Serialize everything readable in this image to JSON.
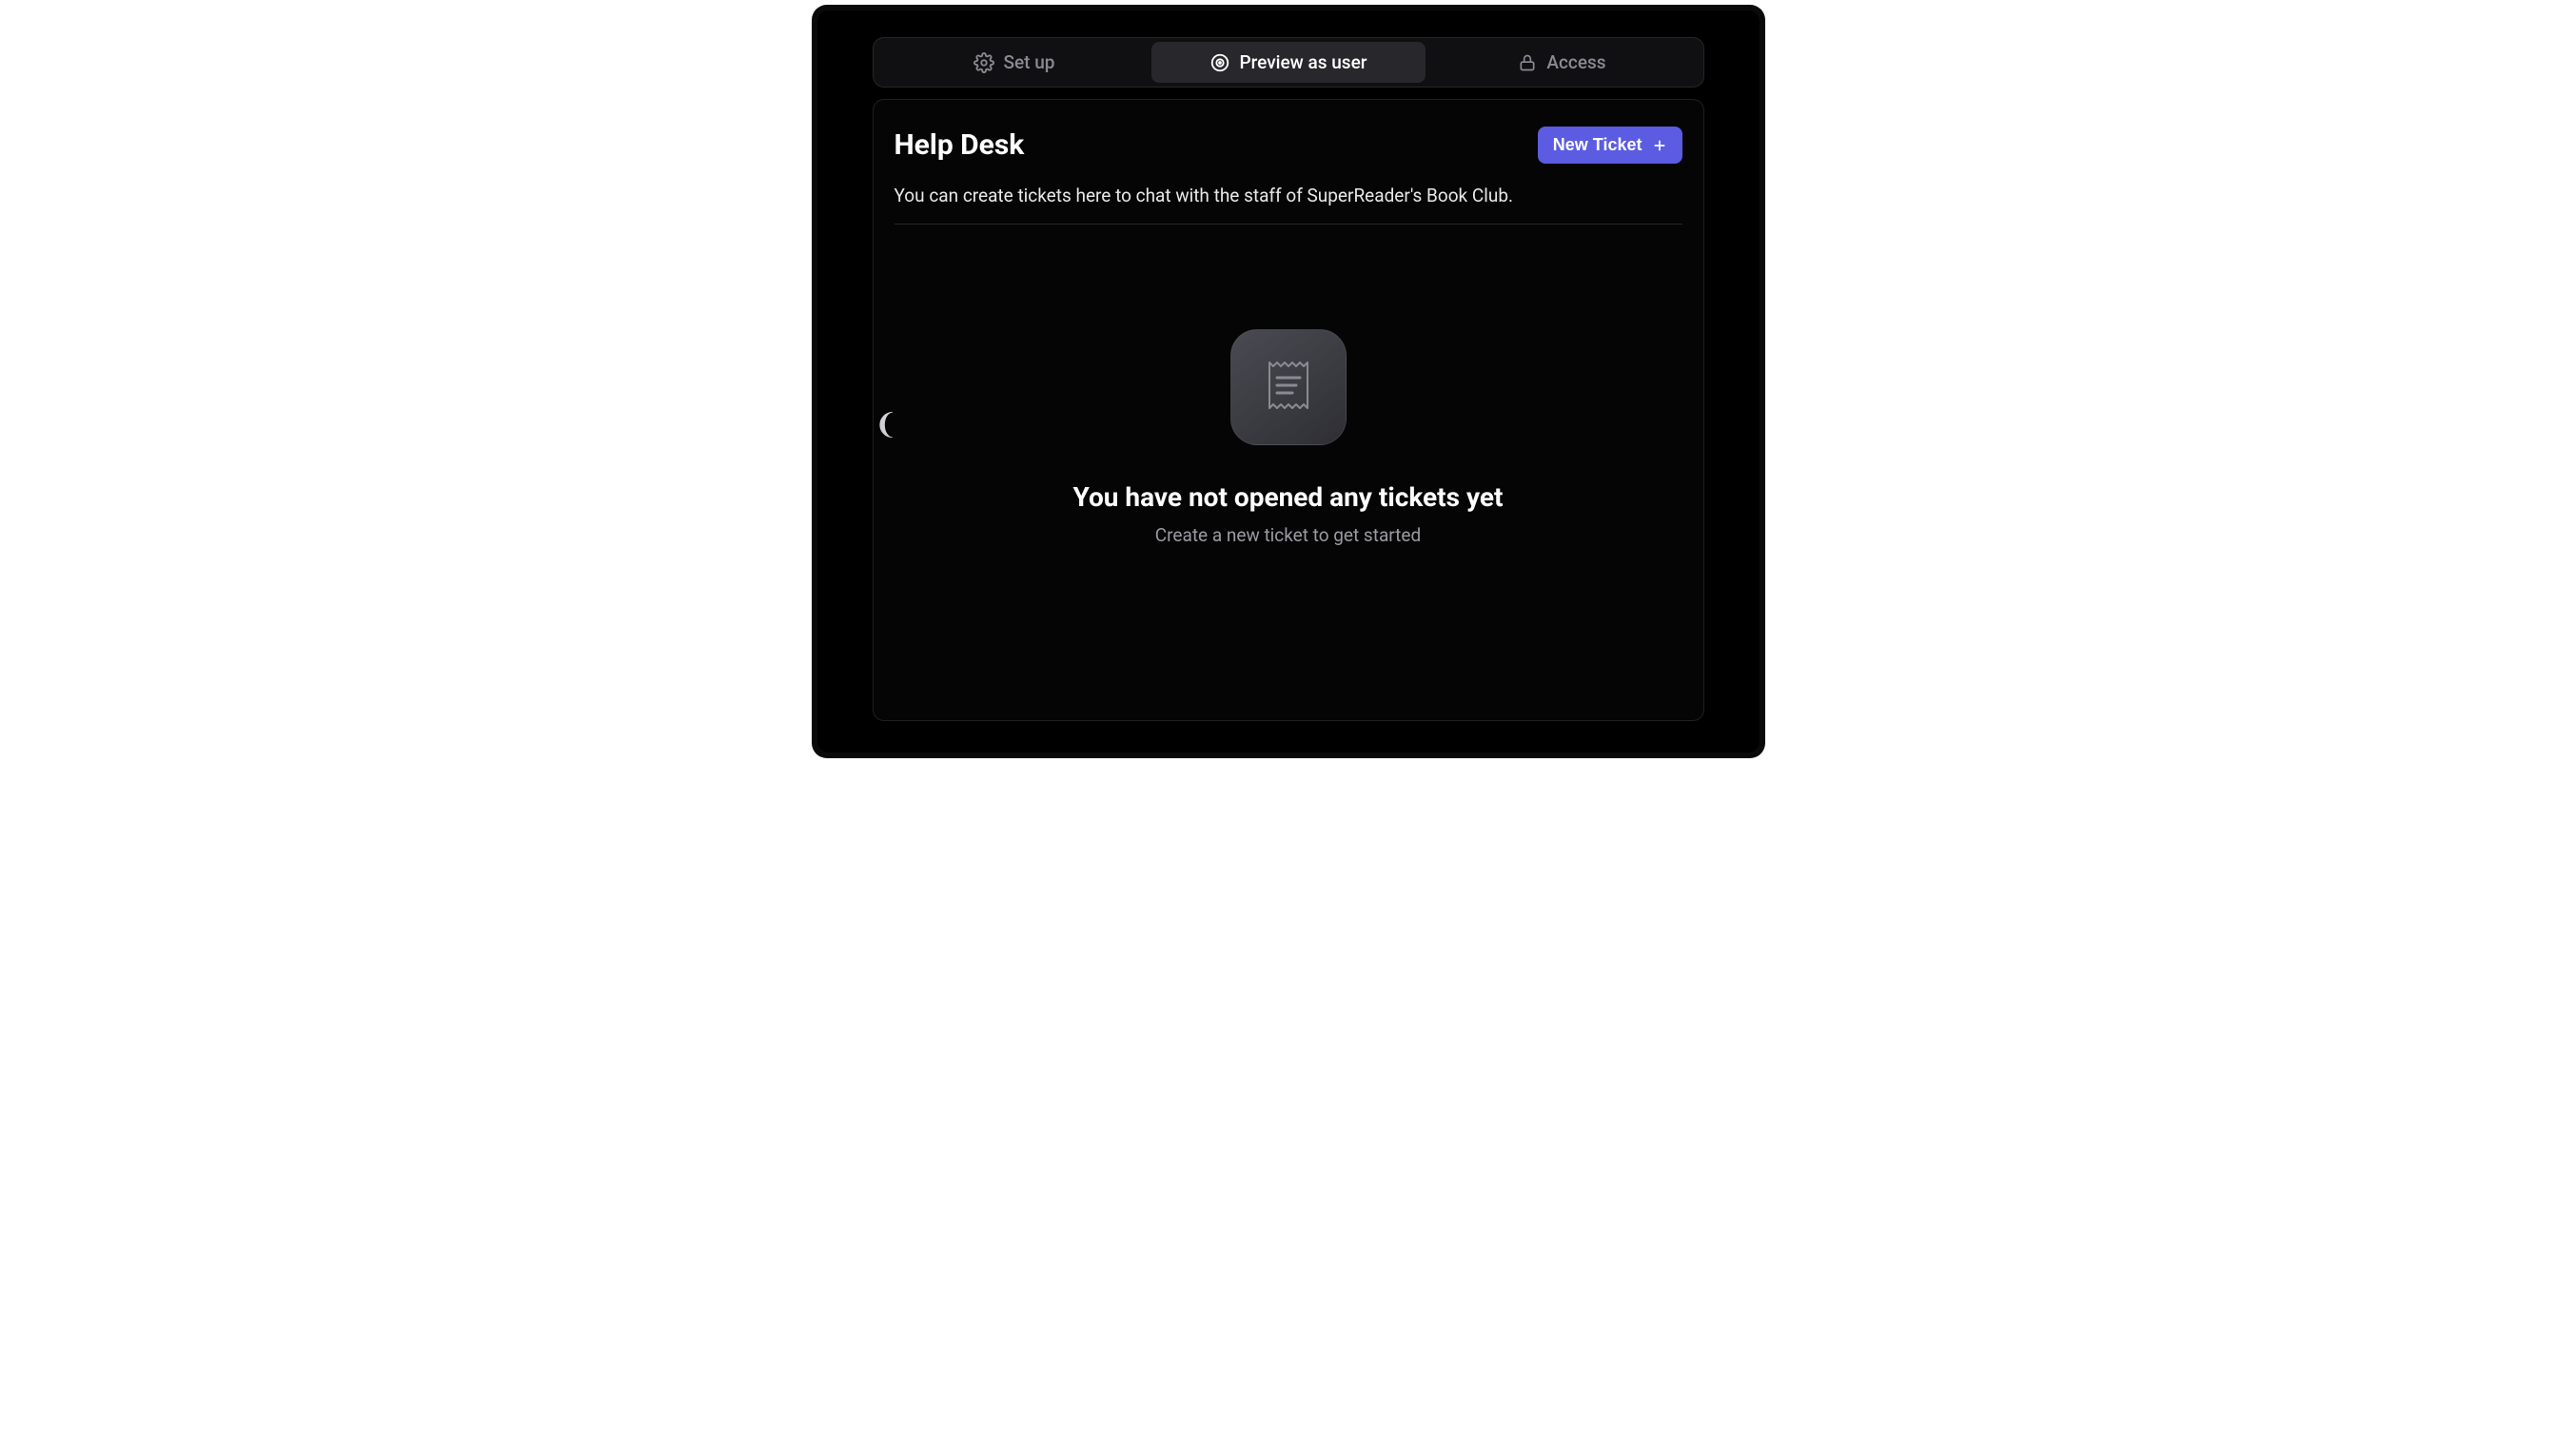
{
  "tabs": {
    "setup": {
      "label": "Set up"
    },
    "preview": {
      "label": "Preview as user"
    },
    "access": {
      "label": "Access"
    }
  },
  "header": {
    "title": "Help Desk",
    "new_ticket_label": "New Ticket"
  },
  "description": "You can create tickets here to chat with the staff of SuperReader's Book Club.",
  "empty_state": {
    "title": "You have not opened any tickets yet",
    "subtitle": "Create a new ticket to get started"
  }
}
